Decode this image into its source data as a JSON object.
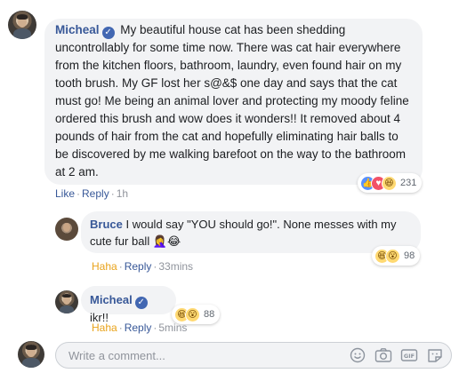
{
  "comments": [
    {
      "author": "Micheal",
      "text": "My beautiful house cat has been shedding uncontrollably for some time now. There was cat hair everywhere from the kitchen floors, bathroom, laundry, even found hair on my tooth brush. My GF lost her s@&$ one day and says that the cat must go! Me being an animal lover and protecting my moody feline ordered this brush and wow does it wonders!! It removed about 4 pounds of hair from the cat and hopefully eliminating hair balls to be discovered by me walking barefoot on the way to the bathroom at 2 am.",
      "action1": "Like",
      "action2": "Reply",
      "time": "1h",
      "reaction_count": "231",
      "reactions": [
        "like-icon",
        "love-icon",
        "haha-icon"
      ]
    }
  ],
  "replies": [
    {
      "author": "Bruce",
      "text": "I would say \"YOU should go!\". None messes with my cute fur ball",
      "emoji": "🤦‍♀️😂",
      "action1": "Haha",
      "action2": "Reply",
      "time": "33mins",
      "reaction_count": "98",
      "reactions": [
        "haha-icon",
        "wow-icon"
      ]
    },
    {
      "author": "Micheal",
      "text": "ikr!!",
      "action1": "Haha",
      "action2": "Reply",
      "time": "5mins",
      "reaction_count": "88",
      "reactions": [
        "haha-icon",
        "wow-icon"
      ]
    }
  ],
  "composer": {
    "placeholder": "Write a comment...",
    "icons": [
      "emoji-icon",
      "camera-icon",
      "gif-icon",
      "sticker-icon"
    ]
  },
  "colors": {
    "name_blue": "#385898",
    "bubble_bg": "#f2f3f5",
    "haha_orange": "#e9a31b",
    "verified_blue": "#4267b2"
  }
}
